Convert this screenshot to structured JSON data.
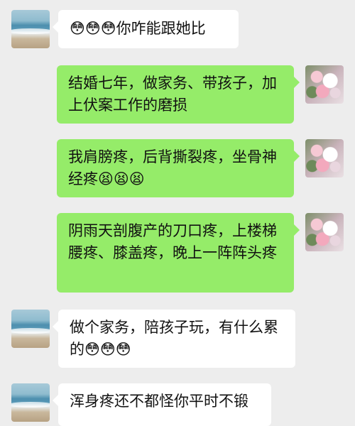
{
  "chat": {
    "messages": [
      {
        "side": "left",
        "text": "😳😳😳你咋能跟她比"
      },
      {
        "side": "right",
        "text": "结婚七年，做家务、带孩子，加上伏案工作的磨损"
      },
      {
        "side": "right",
        "text": "我肩膀疼，后背撕裂疼，坐骨神经疼😫😫😫"
      },
      {
        "side": "right",
        "text": "阴雨天剖腹产的刀口疼，上楼梯腰疼、膝盖疼，晚上一阵阵头疼"
      },
      {
        "side": "left",
        "text": "做个家务，陪孩子玩，有什么累的😳😳😳"
      },
      {
        "side": "left",
        "text": "浑身疼还不都怪你平时不锻"
      }
    ]
  },
  "colors": {
    "background": "#ededed",
    "sent_bubble": "#95ec69",
    "received_bubble": "#ffffff"
  },
  "avatars": {
    "contact": "beach-photo-avatar",
    "self": "flowers-photo-avatar"
  }
}
